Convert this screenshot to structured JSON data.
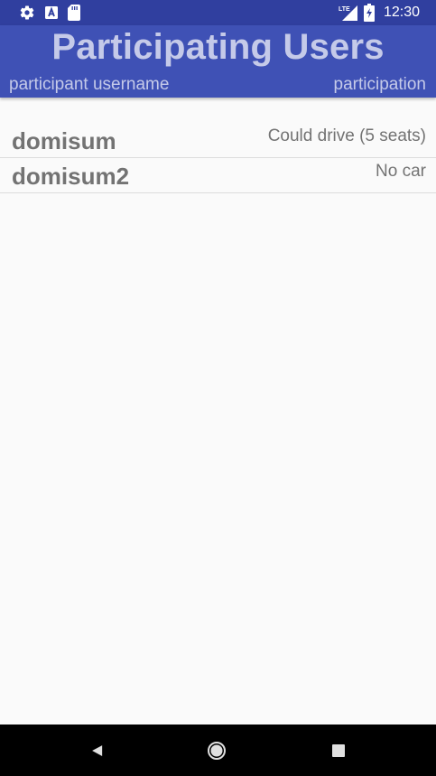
{
  "status_bar": {
    "time": "12:30",
    "network": "LTE",
    "left_icons": [
      "gear-icon",
      "keyboard-a-icon",
      "sd-card-icon"
    ],
    "right_icons": [
      "lte-signal-icon",
      "battery-charging-icon"
    ]
  },
  "header": {
    "title": "Participating Users",
    "column_left": "participant username",
    "column_right": "participation"
  },
  "participants": [
    {
      "username": "domisum",
      "participation": "Could drive (5 seats)"
    },
    {
      "username": "domisum2",
      "participation": "No car"
    }
  ],
  "nav_bar": {
    "buttons": [
      "back-icon",
      "home-icon",
      "recents-icon"
    ]
  },
  "colors": {
    "status_bar": "#303f9f",
    "header": "#3f51b5",
    "header_text": "#c5cae9",
    "list_text": "#737373",
    "background": "#fafafa",
    "nav_bar": "#000000"
  }
}
